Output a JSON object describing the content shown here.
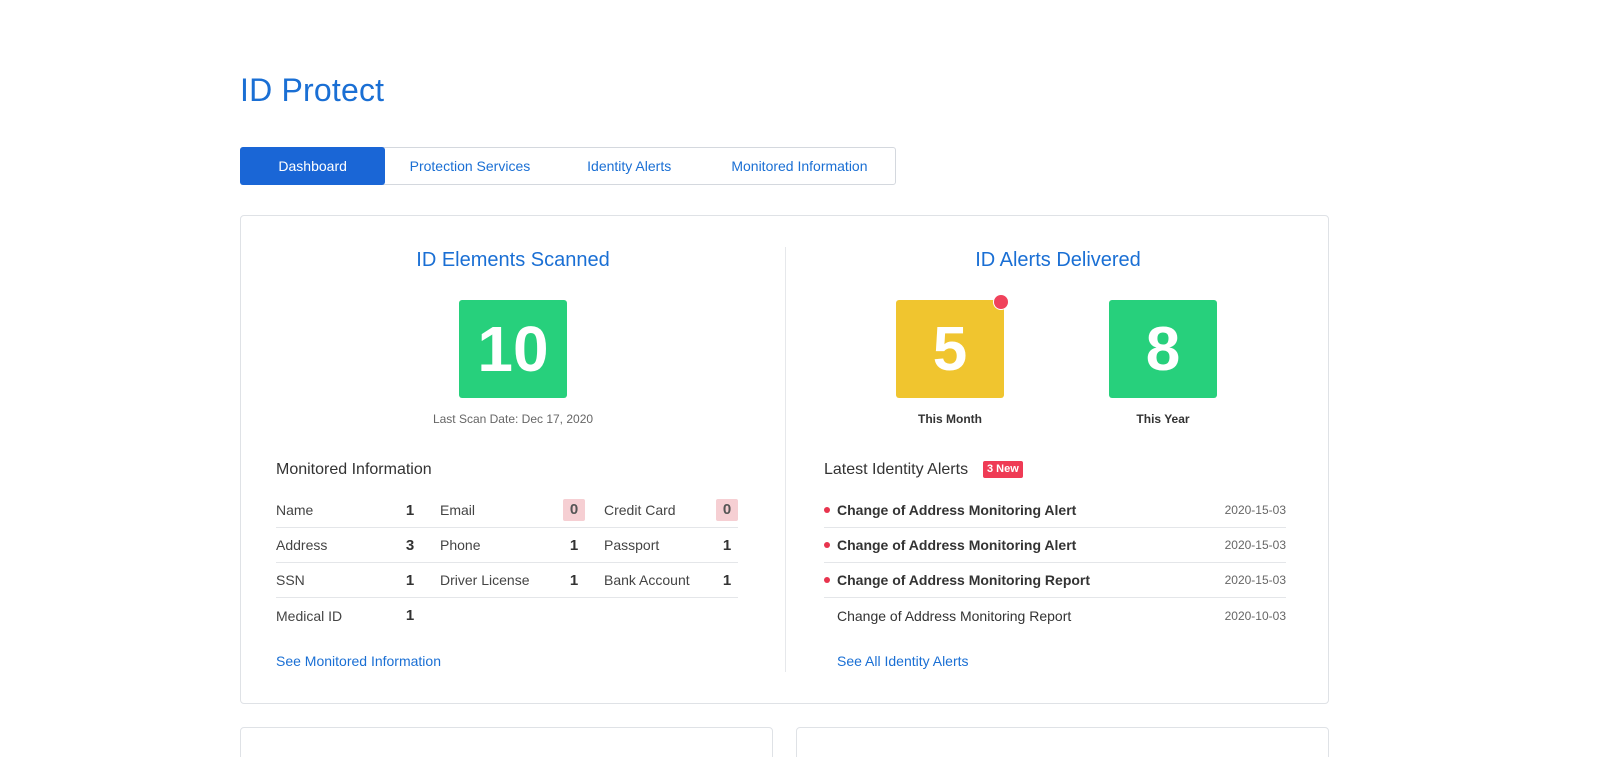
{
  "page": {
    "title": "ID Protect"
  },
  "tabs": [
    {
      "label": "Dashboard",
      "active": true
    },
    {
      "label": "Protection Services",
      "active": false
    },
    {
      "label": "Identity Alerts",
      "active": false
    },
    {
      "label": "Monitored Information",
      "active": false
    }
  ],
  "scanned": {
    "title": "ID Elements Scanned",
    "count": "10",
    "last_scan": "Last Scan Date: Dec 17, 2020"
  },
  "delivered": {
    "title": "ID Alerts Delivered",
    "month_value": "5",
    "month_label": "This Month",
    "year_value": "8",
    "year_label": "This Year"
  },
  "monitored": {
    "heading": "Monitored Information",
    "rows": [
      [
        {
          "name": "Name",
          "count": "1"
        },
        {
          "name": "Email",
          "count": "0"
        },
        {
          "name": "Credit Card",
          "count": "0"
        }
      ],
      [
        {
          "name": "Address",
          "count": "3"
        },
        {
          "name": "Phone",
          "count": "1"
        },
        {
          "name": "Passport",
          "count": "1"
        }
      ],
      [
        {
          "name": "SSN",
          "count": "1"
        },
        {
          "name": "Driver License",
          "count": "1"
        },
        {
          "name": "Bank Account",
          "count": "1"
        }
      ],
      [
        {
          "name": "Medical ID",
          "count": "1"
        }
      ]
    ],
    "link": "See Monitored Information"
  },
  "alerts": {
    "heading": "Latest Identity Alerts",
    "badge": "3 New",
    "items": [
      {
        "title": "Change of Address Monitoring Alert",
        "date": "2020-15-03",
        "unread": true
      },
      {
        "title": "Change of Address Monitoring Alert",
        "date": "2020-15-03",
        "unread": true
      },
      {
        "title": "Change of Address Monitoring Report",
        "date": "2020-15-03",
        "unread": true
      },
      {
        "title": "Change of Address Monitoring Report",
        "date": "2020-10-03",
        "unread": false
      }
    ],
    "link": "See All Identity Alerts"
  },
  "colors": {
    "brand_blue": "#1a6fd4",
    "success_green": "#27d07c",
    "warning_yellow": "#f0c52f",
    "alert_red": "#ef3b55"
  }
}
